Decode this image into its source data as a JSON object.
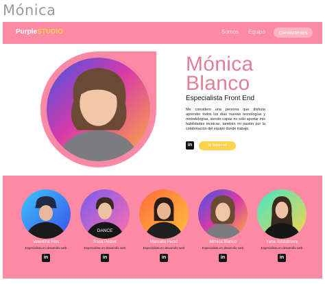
{
  "page_heading": "Mónica",
  "navbar": {
    "brand_part1": "Purple",
    "brand_part2": "STUDIO",
    "links": [
      "Somos",
      "Equipo"
    ],
    "cta": "Contáctenos"
  },
  "hero": {
    "name_line1": "Mónica",
    "name_line2": "Blanco",
    "role": "Especialista Front End",
    "bio": "Me considero una persona que disfruta aprender todos los días nuevas tecnologías y metodologías, siendo capaz no sólo aportar mis habilidades técnicas, también mi pasión por la colaboración del equipo donde trabaje.",
    "linkedin_icon": "in",
    "button": "Te llamamos"
  },
  "team": [
    {
      "name": "Valentina Rios",
      "role": "Especialista en desarrollo web",
      "linkedin_icon": "in"
    },
    {
      "name": "Rosa Pedret",
      "role": "Especialista en desarrollo web",
      "linkedin_icon": "in"
    },
    {
      "name": "Manuela Perez",
      "role": "Especialista en desarrollo web",
      "linkedin_icon": "in"
    },
    {
      "name": "Mónica Blanco",
      "role": "Especialista en desarrollo web",
      "linkedin_icon": "in"
    },
    {
      "name": "Yana Tolstobrova",
      "role": "Especialista en desarrollo web",
      "linkedin_icon": "in"
    }
  ],
  "colors": {
    "pink": "#fd8aa4",
    "yellow": "#ffd24c",
    "name_pink": "#e37f95"
  }
}
